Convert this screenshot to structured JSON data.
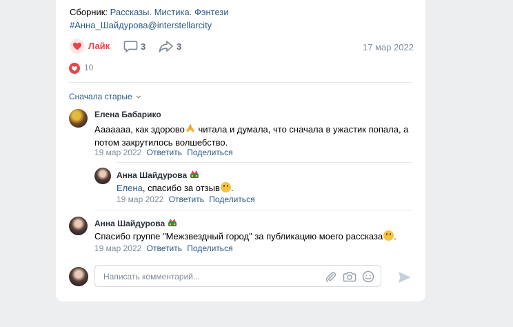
{
  "post": {
    "collection_prefix": "Сборник: ",
    "collection_links": "Рассказы. Мистика. Фэнтези",
    "hashtag": "#Анна_Шайдурова@interstellarcity",
    "like_label": "Лайк",
    "comments_count": "3",
    "shares_count": "3",
    "date": "17 мар 2022",
    "likes_count": "10",
    "colors": {
      "accent": "#2a5885",
      "like": "#e64646",
      "meta": "#818c99"
    }
  },
  "comments": {
    "sort_label": "Сначала старые",
    "items": [
      {
        "author": "Елена Бабарико",
        "text_a": "Ааааааа, как здорово",
        "text_b": " читала и думала, что сначала в ужастик попала, а",
        "text_c": "потом закрутилось волшебство.",
        "date": "19 мар 2022",
        "reply": "Ответить",
        "share": "Поделиться"
      },
      {
        "author": "Анна Шайдурова",
        "mention": "Елена",
        "text": ", спасибо за отзыв",
        "date": "19 мар 2022",
        "reply": "Ответить",
        "share": "Поделиться"
      },
      {
        "author": "Анна Шайдурова",
        "text": "Спасибо группе \"Межзвездный город\" за публикацию моего рассказа",
        "date": "19 мар 2022",
        "reply": "Ответить",
        "share": "Поделиться"
      }
    ]
  },
  "composer": {
    "placeholder": "Написать комментарий..."
  }
}
